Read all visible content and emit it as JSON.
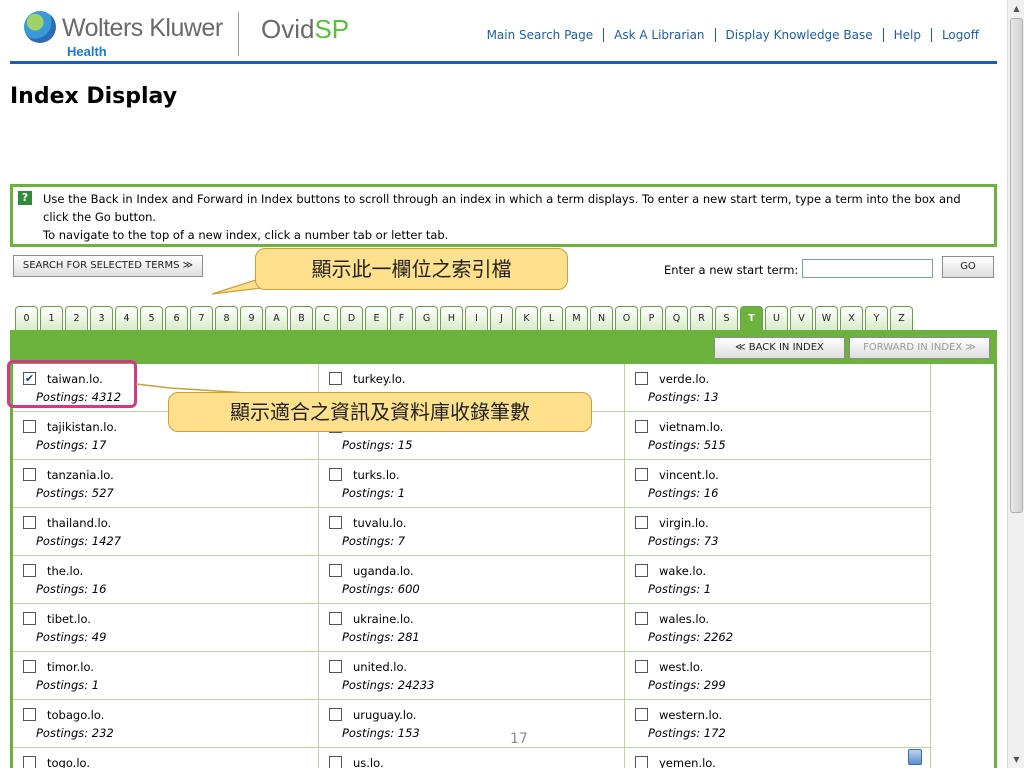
{
  "header": {
    "brand": "Wolters Kluwer",
    "brand_sub": "Health",
    "product_main": "Ovid",
    "product_accent": "SP",
    "nav": [
      "Main Search Page",
      "Ask A Librarian",
      "Display Knowledge Base",
      "Help",
      "Logoff"
    ]
  },
  "page_title": "Index Display",
  "help": {
    "icon": "?",
    "line1": "Use the Back in Index and Forward in Index buttons to scroll through an index in which a term displays. To enter a new start term, type a term into the box and click the Go button.",
    "line2": "To navigate to the top of a new index, click a number tab or letter tab."
  },
  "toolbar": {
    "search_selected": "SEARCH FOR SELECTED TERMS ≫",
    "start_term_label": "Enter a new start term:",
    "start_term_value": "",
    "go": "GO"
  },
  "tabs": [
    "0",
    "1",
    "2",
    "3",
    "4",
    "5",
    "6",
    "7",
    "8",
    "9",
    "A",
    "B",
    "C",
    "D",
    "E",
    "F",
    "G",
    "H",
    "I",
    "J",
    "K",
    "L",
    "M",
    "N",
    "O",
    "P",
    "Q",
    "R",
    "S",
    "T",
    "U",
    "V",
    "W",
    "X",
    "Y",
    "Z"
  ],
  "active_tab": "T",
  "index_nav": {
    "back": "≪ BACK IN INDEX",
    "forward": "FORWARD IN INDEX ≫"
  },
  "postings_label": "Postings:",
  "terms": [
    [
      {
        "term": "taiwan.lo.",
        "postings": "4312",
        "checked": true
      },
      {
        "term": "turkey.lo.",
        "postings": "",
        "checked": false
      },
      {
        "term": "verde.lo.",
        "postings": "13",
        "checked": false
      }
    ],
    [
      {
        "term": "tajikistan.lo.",
        "postings": "17",
        "checked": false
      },
      {
        "term": "",
        "postings": "15",
        "checked": false
      },
      {
        "term": "vietnam.lo.",
        "postings": "515",
        "checked": false
      }
    ],
    [
      {
        "term": "tanzania.lo.",
        "postings": "527",
        "checked": false
      },
      {
        "term": "turks.lo.",
        "postings": "1",
        "checked": false
      },
      {
        "term": "vincent.lo.",
        "postings": "16",
        "checked": false
      }
    ],
    [
      {
        "term": "thailand.lo.",
        "postings": "1427",
        "checked": false
      },
      {
        "term": "tuvalu.lo.",
        "postings": "7",
        "checked": false
      },
      {
        "term": "virgin.lo.",
        "postings": "73",
        "checked": false
      }
    ],
    [
      {
        "term": "the.lo.",
        "postings": "16",
        "checked": false
      },
      {
        "term": "uganda.lo.",
        "postings": "600",
        "checked": false
      },
      {
        "term": "wake.lo.",
        "postings": "1",
        "checked": false
      }
    ],
    [
      {
        "term": "tibet.lo.",
        "postings": "49",
        "checked": false
      },
      {
        "term": "ukraine.lo.",
        "postings": "281",
        "checked": false
      },
      {
        "term": "wales.lo.",
        "postings": "2262",
        "checked": false
      }
    ],
    [
      {
        "term": "timor.lo.",
        "postings": "1",
        "checked": false
      },
      {
        "term": "united.lo.",
        "postings": "24233",
        "checked": false
      },
      {
        "term": "west.lo.",
        "postings": "299",
        "checked": false
      }
    ],
    [
      {
        "term": "tobago.lo.",
        "postings": "232",
        "checked": false
      },
      {
        "term": "uruguay.lo.",
        "postings": "153",
        "checked": false
      },
      {
        "term": "western.lo.",
        "postings": "172",
        "checked": false
      }
    ],
    [
      {
        "term": "togo.lo.",
        "postings": "",
        "checked": false
      },
      {
        "term": "us.lo.",
        "postings": "",
        "checked": false
      },
      {
        "term": "yemen.lo.",
        "postings": "",
        "checked": false
      }
    ]
  ],
  "callouts": {
    "index_field": "顯示此一欄位之索引檔",
    "postings_info": "顯示適合之資訊及資料庫收錄筆數"
  },
  "slide_number": "17",
  "colors": {
    "brand_blue": "#1c5ea8",
    "green": "#6cb33e",
    "highlight": "#d23a86",
    "callout_fill": "#ffe08c"
  }
}
